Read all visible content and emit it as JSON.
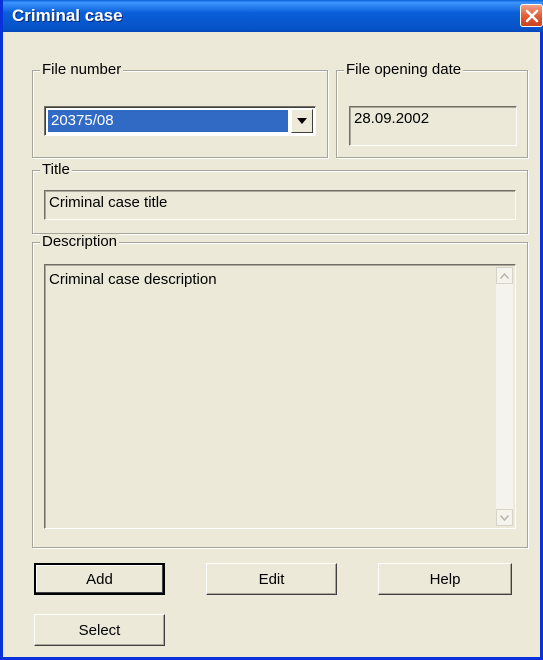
{
  "window": {
    "title": "Criminal case"
  },
  "file_number": {
    "label": "File number",
    "value": "20375/08"
  },
  "file_opening_date": {
    "label": "File opening date",
    "value": "28.09.2002"
  },
  "title_group": {
    "label": "Title",
    "value": "Criminal case title"
  },
  "description_group": {
    "label": "Description",
    "value": "Criminal case description"
  },
  "buttons": {
    "add": "Add",
    "edit": "Edit",
    "help": "Help",
    "select": "Select"
  }
}
